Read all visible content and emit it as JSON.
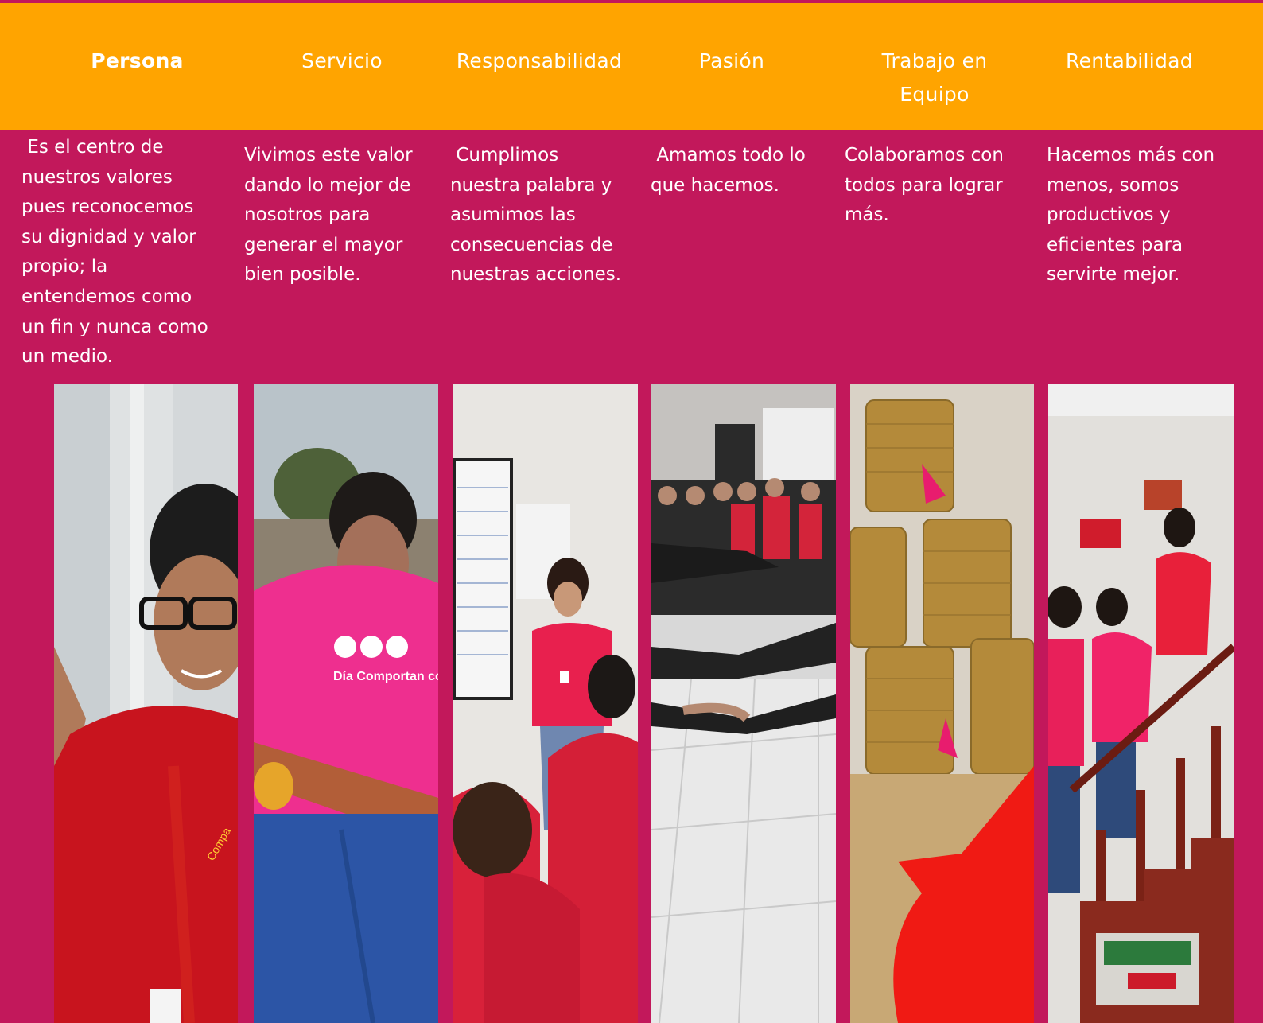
{
  "values": [
    {
      "title": "Persona",
      "description": " Es el centro de\nnuestros valores\npues reconocemos\nsu dignidad y valor\npropio; la\nentendemos como\nun fin y nunca como\nun medio."
    },
    {
      "title": "Servicio",
      "description": "Vivimos este valor\ndando lo mejor de\nnosotros para\ngenerar el mayor\nbien posible."
    },
    {
      "title": "Responsabilidad",
      "description": " Cumplimos\nnuestra palabra y\nasumimos las\nconsecuencias de\nnuestras acciones."
    },
    {
      "title": "Pasión",
      "description": " Amamos todo lo\nque hacemos."
    },
    {
      "title": "Trabajo en\nEquipo",
      "description": "Colaboramos con\ntodos para lograr\nmás."
    },
    {
      "title": "Rentabilidad",
      "description": "Hacemos más con\nmenos, somos\nproductivos y\neficientes para\nservirte mejor."
    }
  ],
  "photos": [
    {
      "shirt_text": "Compa"
    },
    {
      "shirt_text": "Día Comportan con tu Comunid"
    },
    {
      "shirt_text": ""
    },
    {
      "shirt_text": ""
    },
    {
      "shirt_text": ""
    },
    {
      "shirt_text": ""
    }
  ],
  "colors": {
    "header": "#FFA400",
    "background": "#C2185B",
    "text": "#FFFFFF"
  }
}
